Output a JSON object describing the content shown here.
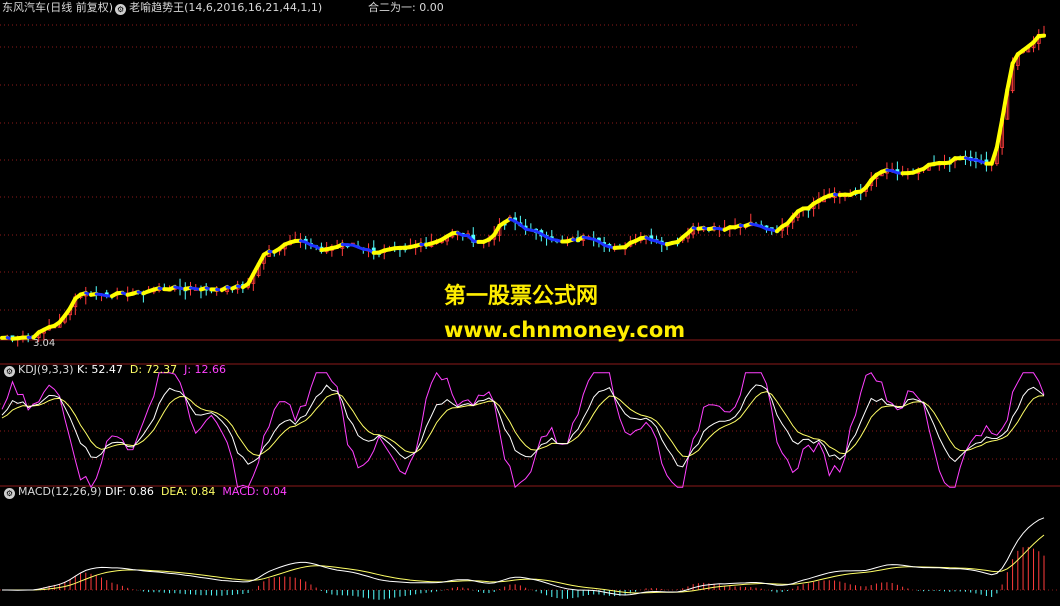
{
  "header": {
    "stock": "东风汽车(日线 前复权)",
    "indicator": "老喻趋势王(14,6,2016,16,21,44,1,1)",
    "combo_label": "合二为一: 0.00",
    "low_price_label": "3.04"
  },
  "kdj": {
    "name": "KDJ(9,3,3)",
    "k_label": "K: 52.47",
    "d_label": "D: 72.37",
    "j_label": "J: 12.66"
  },
  "macd": {
    "name": "MACD(12,26,9)",
    "dif_label": "DIF: 0.86",
    "dea_label": "DEA: 0.84",
    "macd_label": "MACD: 0.04"
  },
  "watermark": {
    "line1": "第一股票公式网",
    "line2": "www.chnmoney.com"
  },
  "colors": {
    "background": "#000000",
    "up_candle": "#ff3c3c",
    "down_candle": "#54ffff",
    "trend_up": "#ffff00",
    "trend_down": "#1e32ff",
    "k_line": "#ffffff",
    "d_line": "#ffff66",
    "j_line": "#ff40ff",
    "macd_pos": "#ff3c3c",
    "macd_neg": "#54ffff",
    "grid": "#8b1a1a",
    "watermark": "#ffee00"
  },
  "chart_data": {
    "type": "candlestick",
    "title": "东风汽车(日线 前复权)",
    "price_trend_anchors": [
      3.04,
      3.05,
      3.3,
      3.95,
      3.92,
      3.95,
      4.05,
      4.06,
      4.04,
      4.08,
      4.8,
      5.05,
      4.85,
      4.95,
      4.8,
      4.86,
      4.98,
      5.18,
      5.0,
      5.45,
      5.2,
      5.0,
      5.1,
      4.86,
      5.1,
      4.96,
      5.3,
      5.28,
      5.35,
      5.25,
      5.7,
      5.95,
      6.0,
      6.45,
      6.4,
      6.6,
      6.72,
      6.6,
      8.85,
      9.25
    ],
    "price_low_label": 3.04,
    "kdj": {
      "k": 52.47,
      "d": 72.37,
      "j": 12.66
    },
    "macd": {
      "dif": 0.86,
      "dea": 0.84,
      "macd": 0.04
    }
  }
}
